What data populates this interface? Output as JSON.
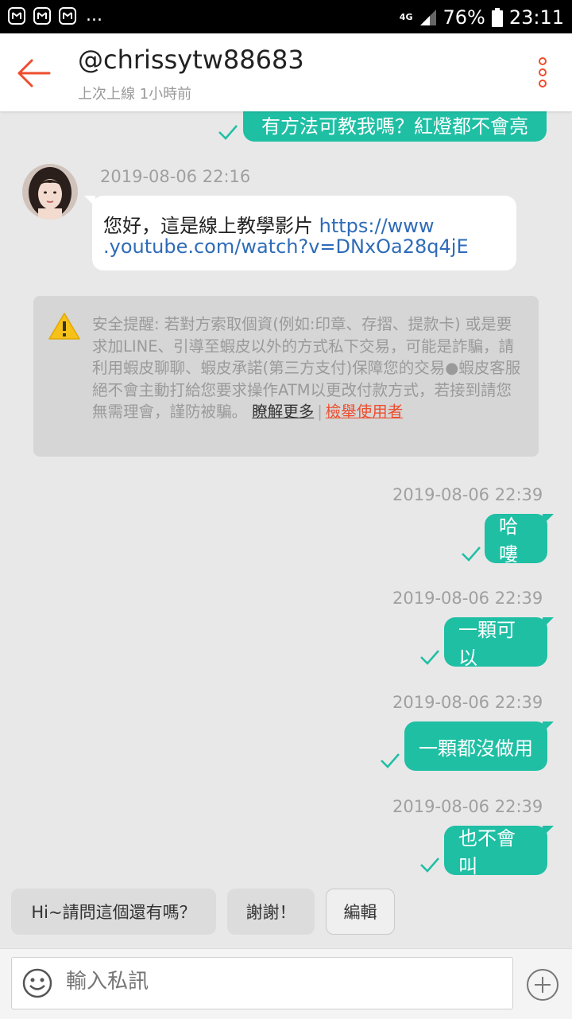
{
  "status_bar": {
    "network": "4G",
    "battery": "76%",
    "time": "23:11",
    "overflow": "..."
  },
  "header": {
    "title": "@chrissytw88683",
    "subtitle": "上次上線 1小時前",
    "back_icon": "arrow-left-icon",
    "more_icon": "vertical-dots-icon"
  },
  "messages": {
    "top_out": "有方法可教我嗎？紅燈都不會亮",
    "incoming": {
      "time": "2019-08-06 22:16",
      "text": "您好，這是線上教學影片 ",
      "link_part1": "https://www",
      "link_part2": ".youtube.com/watch?v=DNxOa28q4jE"
    },
    "out": [
      {
        "time": "2019-08-06 22:39",
        "text": "哈嘍"
      },
      {
        "time": "2019-08-06 22:39",
        "text": "一顆可以"
      },
      {
        "time": "2019-08-06 22:39",
        "text": "一顆都沒做用"
      },
      {
        "time": "2019-08-06 22:39",
        "text": "也不會叫"
      }
    ]
  },
  "notice": {
    "text": "安全提醒: 若對方索取個資(例如:印章、存摺、提款卡) 或是要求加LINE、引導至蝦皮以外的方式私下交易，可能是詐騙，請利用蝦皮聊聊、蝦皮承諾(第三方支付)保障您的交易●蝦皮客服絕不會主動打給您要求操作ATM以更改付款方式，若接到請您無需理會，謹防被騙。 ",
    "learn_more": "瞭解更多",
    "separator": "|",
    "report": "檢舉使用者"
  },
  "quick_replies": {
    "reply1": "Hi~請問這個還有嗎？",
    "reply2": "謝謝！",
    "edit": "編輯"
  },
  "input": {
    "placeholder": "輸入私訊"
  },
  "colors": {
    "accent": "#1fbfa4",
    "brand": "#ee4d2d",
    "background": "#e8e8e8"
  }
}
